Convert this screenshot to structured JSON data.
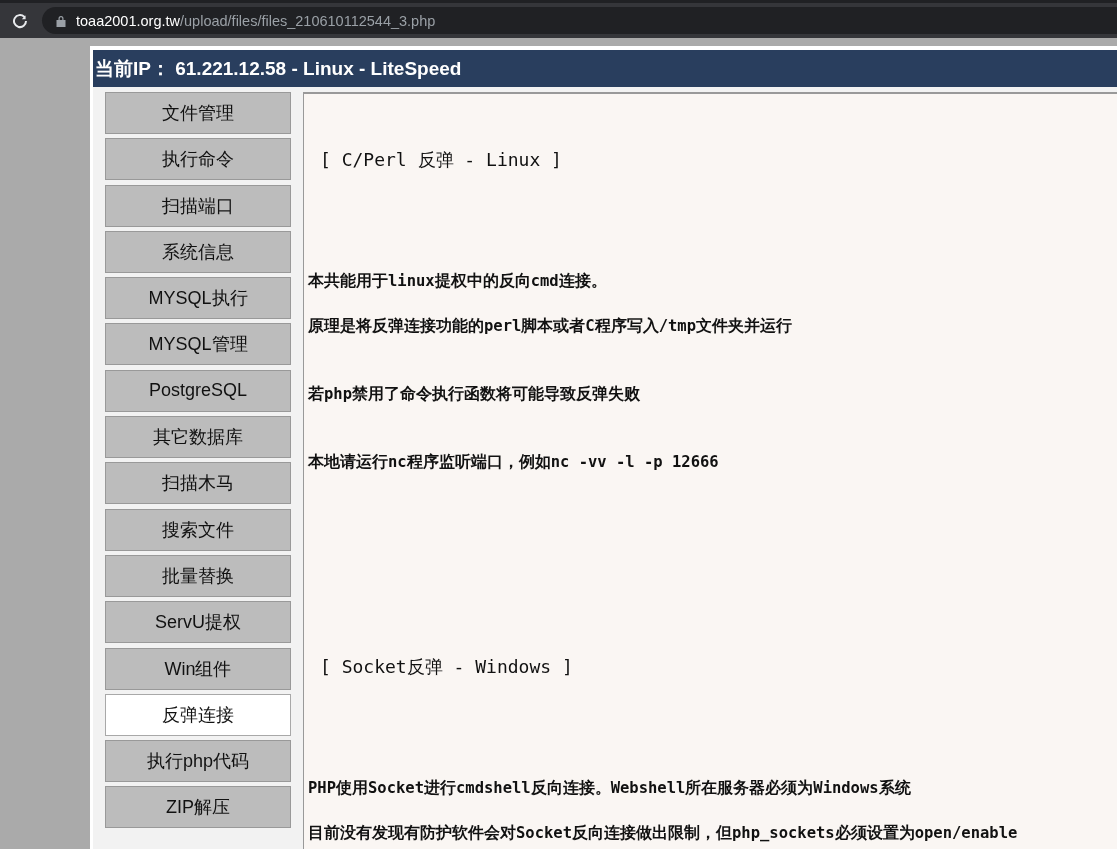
{
  "browser": {
    "host": "toaa2001.org.tw",
    "path": "/upload/files/files_210610112544_3.php"
  },
  "header": {
    "title": "当前IP： 61.221.12.58 - Linux - LiteSpeed"
  },
  "sidebar": {
    "items": [
      {
        "label": "文件管理",
        "selected": false
      },
      {
        "label": "执行命令",
        "selected": false
      },
      {
        "label": "扫描端口",
        "selected": false
      },
      {
        "label": "系统信息",
        "selected": false
      },
      {
        "label": "MYSQL执行",
        "selected": false
      },
      {
        "label": "MYSQL管理",
        "selected": false
      },
      {
        "label": "PostgreSQL",
        "selected": false
      },
      {
        "label": "其它数据库",
        "selected": false
      },
      {
        "label": "扫描木马",
        "selected": false
      },
      {
        "label": "搜索文件",
        "selected": false
      },
      {
        "label": "批量替换",
        "selected": false
      },
      {
        "label": "ServU提权",
        "selected": false
      },
      {
        "label": "Win组件",
        "selected": false
      },
      {
        "label": "反弹连接",
        "selected": true
      },
      {
        "label": "执行php代码",
        "selected": false
      },
      {
        "label": "ZIP解压",
        "selected": false
      }
    ]
  },
  "content": {
    "sections": [
      {
        "title": "[ C/Perl 反弹 - Linux ]",
        "paragraphs": [
          "本共能用于linux提权中的反向cmd连接。",
          "原理是将反弹连接功能的perl脚本或者C程序写入/tmp文件夹并运行",
          "若php禁用了命令执行函数将可能导致反弹失败",
          "本地请运行nc程序监听端口，例如nc -vv -l -p 12666"
        ]
      },
      {
        "title": "[ Socket反弹 - Windows ]",
        "paragraphs": [
          "PHP使用Socket进行cmdshell反向连接。Webshell所在服务器必须为Windows系统",
          "目前没有发现有防护软件会对Socket反向连接做出限制，但php_sockets必须设置为open/enable"
        ]
      }
    ]
  }
}
